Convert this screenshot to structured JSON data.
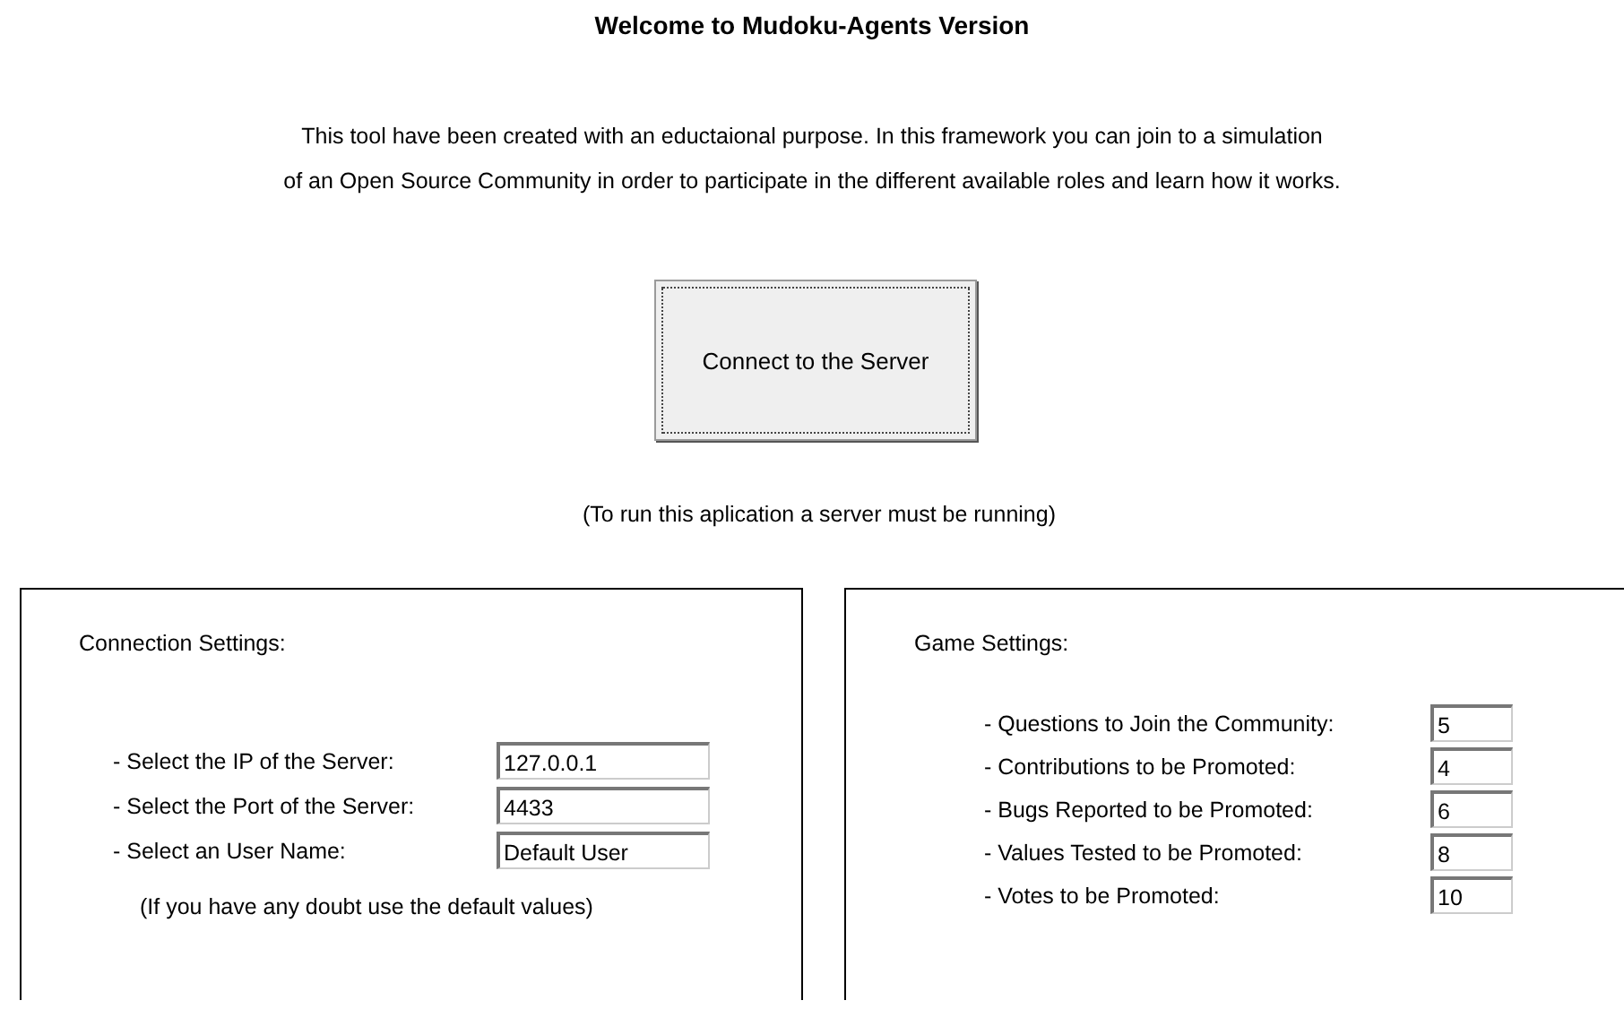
{
  "title": "Welcome to Mudoku-Agents Version",
  "intro": [
    "This tool have been created with an eductaional purpose. In this framework you can join to a simulation",
    "of an Open Source Community in order to participate in the different available roles and learn how it works."
  ],
  "connect_button": "Connect to the Server",
  "server_note": "(To run this aplication a server must be running)",
  "connection_settings": {
    "heading": "Connection Settings:",
    "fields": [
      {
        "label": "- Select the IP of the Server:",
        "value": "127.0.0.1"
      },
      {
        "label": "- Select the Port of the Server:",
        "value": "4433"
      },
      {
        "label": "- Select an User Name:",
        "value": "Default User"
      }
    ],
    "note": "(If you have any doubt use the default values)"
  },
  "game_settings": {
    "heading": "Game Settings:",
    "fields": [
      {
        "label": "- Questions to Join the Community:",
        "value": "5"
      },
      {
        "label": "- Contributions to be Promoted:",
        "value": "4"
      },
      {
        "label": "- Bugs Reported to be Promoted:",
        "value": "6"
      },
      {
        "label": "- Values Tested to be Promoted:",
        "value": "8"
      },
      {
        "label": "- Votes to be Promoted:",
        "value": "10"
      }
    ]
  }
}
